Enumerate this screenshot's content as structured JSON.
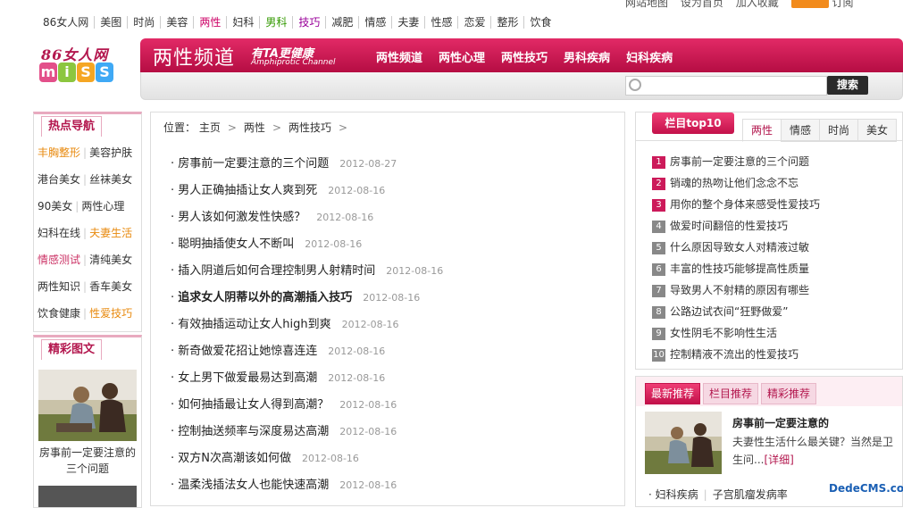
{
  "topstrip": {
    "site_map": "网站地图",
    "homepage": "设为首页",
    "favorite": "加入收藏",
    "rss_label": "RSS",
    "subscribe": "订阅"
  },
  "topnav": [
    "86女人网",
    "美图",
    "时尚",
    "美容",
    "两性",
    "妇科",
    "男科",
    "技巧",
    "减肥",
    "情感",
    "夫妻",
    "性感",
    "恋爱",
    "整形",
    "饮食"
  ],
  "logo": {
    "cn": "86女人网",
    "letters": [
      "m",
      "i",
      "S",
      "S"
    ]
  },
  "banner": {
    "title": "两性频道",
    "slogan": "有TA更健康",
    "slogan_en": "Amphiprotic Channel",
    "nav": [
      "两性频道",
      "两性心理",
      "两性技巧",
      "男科疾病",
      "妇科疾病"
    ]
  },
  "search": {
    "placeholder": "",
    "button": "搜索"
  },
  "hotnav": {
    "title": "热点导航",
    "rows": [
      [
        "丰胸整形",
        "美容护肤"
      ],
      [
        "港台美女",
        "丝袜美女"
      ],
      [
        "90美女",
        "两性心理"
      ],
      [
        "妇科在线",
        "夫妻生活"
      ],
      [
        "情感测试",
        "清纯美女"
      ],
      [
        "两性知识",
        "香车美女"
      ],
      [
        "饮食健康",
        "性爱技巧"
      ]
    ]
  },
  "pics": {
    "title": "精彩图文",
    "caption": "房事前一定要注意的三个问题"
  },
  "breadcrumb": {
    "label": "位置：",
    "items": [
      "主页",
      "两性",
      "两性技巧"
    ]
  },
  "articles": [
    {
      "title": "房事前一定要注意的三个问题",
      "date": "2012-08-27"
    },
    {
      "title": "男人正确抽插让女人爽到死",
      "date": "2012-08-16"
    },
    {
      "title": "男人该如何激发性快感？",
      "date": "2012-08-16"
    },
    {
      "title": "聪明抽插使女人不断叫",
      "date": "2012-08-16"
    },
    {
      "title": "插入阴道后如何合理控制男人射精时间",
      "date": "2012-08-16"
    },
    {
      "title": "追求女人阴蒂以外的高潮插入技巧",
      "date": "2012-08-16"
    },
    {
      "title": "有效抽插运动让女人high到爽",
      "date": "2012-08-16"
    },
    {
      "title": "新奇做爱花招让她惊喜连连",
      "date": "2012-08-16"
    },
    {
      "title": "女上男下做爱最易达到高潮",
      "date": "2012-08-16"
    },
    {
      "title": "如何抽插最让女人得到高潮？",
      "date": "2012-08-16"
    },
    {
      "title": "控制抽送频率与深度易达高潮",
      "date": "2012-08-16"
    },
    {
      "title": "双方N次高潮该如何做",
      "date": "2012-08-16"
    },
    {
      "title": "温柔浅插法女人也能快速高潮",
      "date": "2012-08-16"
    }
  ],
  "top10": {
    "title": "栏目top10",
    "tabs": [
      "两性",
      "情感",
      "时尚",
      "美女"
    ],
    "items": [
      "房事前一定要注意的三个问题",
      "销魂的热吻让他们念念不忘",
      "用你的整个身体来感受性爱技巧",
      "做爱时间翻倍的性爱技巧",
      "什么原因导致女人对精液过敏",
      "丰富的性技巧能够提高性质量",
      "导致男人不射精的原因有哪些",
      "公路边试衣间“狂野做爱”",
      "女性阴毛不影响性生活",
      "控制精液不流出的性爱技巧"
    ]
  },
  "recommend": {
    "tabs": [
      "最新推荐",
      "栏目推荐",
      "精彩推荐"
    ],
    "title": "房事前一定要注意的",
    "desc": "夫妻性生活什么最关键？当然是卫生问...",
    "more": "[详细]",
    "links": [
      "妇科疾病",
      "子宫肌瘤发病率"
    ]
  },
  "watermark": "DedeCMS.com",
  "colors": {
    "brand": "#c3114a",
    "accent_pink": "#e8aabf",
    "orange": "#e88a0f"
  }
}
